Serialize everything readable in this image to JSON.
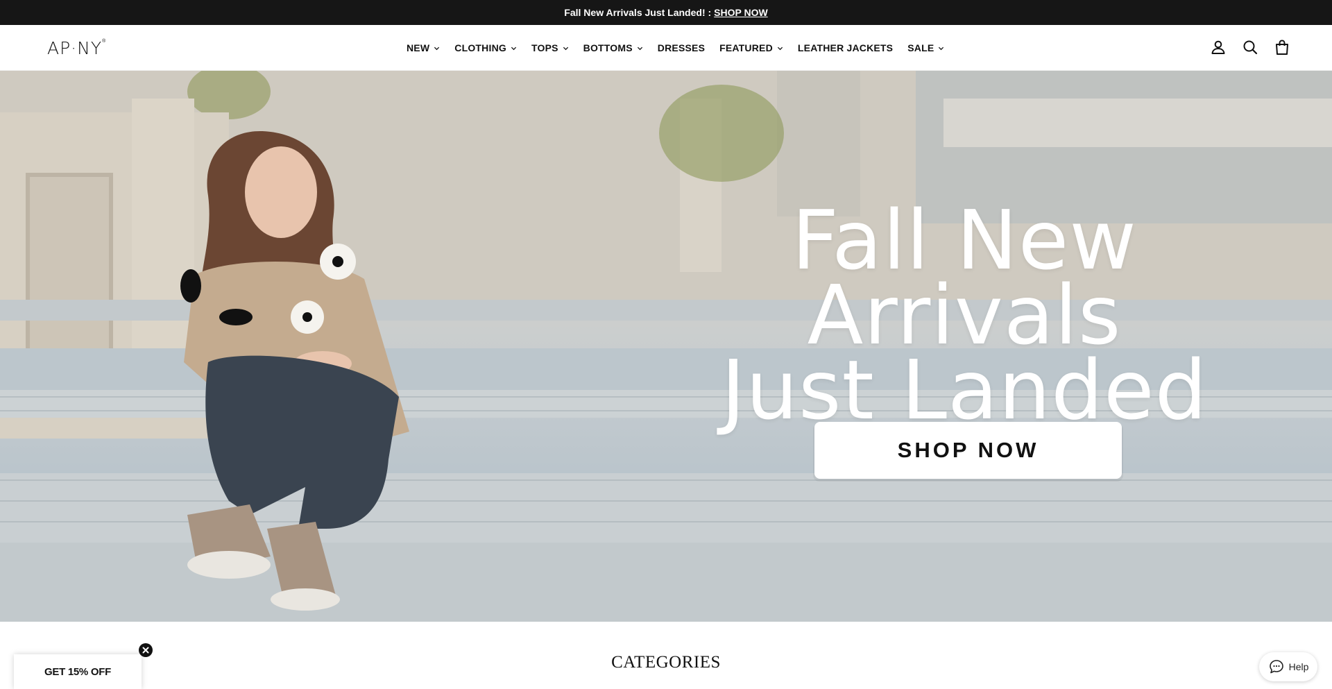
{
  "announcement": {
    "text": "Fall New Arrivals Just Landed! :",
    "link": "SHOP NOW"
  },
  "header": {
    "logo": "AP·NY",
    "logo_mark": "®",
    "nav": [
      {
        "label": "NEW",
        "dropdown": true
      },
      {
        "label": "CLOTHING",
        "dropdown": true
      },
      {
        "label": "TOPS",
        "dropdown": true
      },
      {
        "label": "BOTTOMS",
        "dropdown": true
      },
      {
        "label": "DRESSES",
        "dropdown": false
      },
      {
        "label": "FEATURED",
        "dropdown": true
      },
      {
        "label": "LEATHER JACKETS",
        "dropdown": false
      },
      {
        "label": "SALE",
        "dropdown": true
      }
    ],
    "icons": [
      "account-icon",
      "search-icon",
      "cart-icon"
    ]
  },
  "hero": {
    "title_line1": "Fall New Arrivals",
    "title_line2": "Just Landed",
    "cta": "SHOP NOW"
  },
  "categories": {
    "heading": "CATEGORIES"
  },
  "promo": {
    "label": "GET 15% OFF"
  },
  "help": {
    "label": "Help"
  },
  "colors": {
    "topbar": "#161616",
    "hero_text": "#ffffff",
    "cta_bg": "#ffffff"
  }
}
